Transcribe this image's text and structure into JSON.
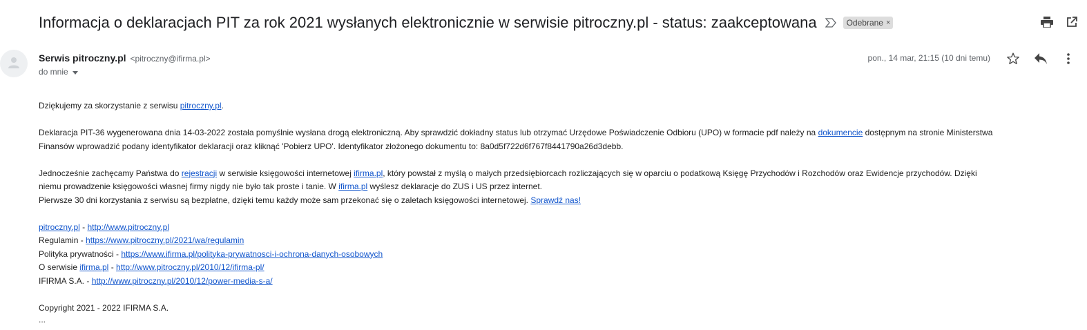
{
  "email": {
    "subject": "Informacja o deklaracjach PIT za rok 2021 wysłanych elektronicznie w serwisie pitroczny.pl - status: zaakceptowana",
    "label": "Odebrane",
    "label_close": "×",
    "sender_name": "Serwis pitroczny.pl",
    "sender_email": "<pitroczny@ifirma.pl>",
    "to": "do mnie",
    "date": "pon., 14 mar, 21:15 (10 dni temu)"
  },
  "body": {
    "p1_text": "Dziękujemy za skorzystanie z serwisu ",
    "p1_link": "pitroczny.pl",
    "p1_end": ".",
    "p2_text_a": "Deklaracja PIT-36 wygenerowana dnia 14-03-2022 została pomyślnie wysłana drogą elektroniczną. Aby sprawdzić dokładny status lub otrzymać Urzędowe Poświadczenie Odbioru (UPO) w formacie pdf należy na ",
    "p2_link": "dokumencie",
    "p2_text_b": " dostępnym na stronie Ministerstwa",
    "p2_text_c": "Finansów wprowadzić podany identyfikator deklaracji oraz kliknąć 'Pobierz UPO'. Identyfikator złożonego dokumentu to: 8a0d5f722d6f767f8441790a26d3debb.",
    "p3_text_a": "Jednocześnie zachęcamy Państwa do ",
    "p3_link_a": "rejestracji",
    "p3_text_b": " w serwisie księgowości internetowej ",
    "p3_link_b": "ifirma.pl",
    "p3_text_c": ", który powstał z myślą o małych przedsiębiorcach rozliczających się w oparciu o podatkową Księgę Przychodów i Rozchodów oraz Ewidencje przychodów. Dzięki",
    "p3_text_d": "niemu prowadzenie księgowości własnej firmy nigdy nie było tak proste i tanie. W ",
    "p3_link_c": "ifirma.pl",
    "p3_text_e": " wyślesz deklaracje do ZUS i US przez internet.",
    "p3_text_f": "Pierwsze 30 dni korzystania z serwisu są bezpłatne, dzięki temu każdy może sam przekonać się o zaletach księgowości internetowej. ",
    "p3_link_d": "Sprawdź nas!",
    "links": {
      "l1_link_a": "pitroczny.pl",
      "l1_sep": " - ",
      "l1_link_b": "http://www.pitroczny.pl",
      "l2_text": "Regulamin - ",
      "l2_link": "https://www.pitroczny.pl/2021/wa/regulamin",
      "l3_text": "Polityka prywatności - ",
      "l3_link": "https://www.ifirma.pl/polityka-prywatnosci-i-ochrona-danych-osobowych",
      "l4_text": "O serwisie ",
      "l4_link_a": "ifirma.pl",
      "l4_sep": " - ",
      "l4_link_b": "http://www.pitroczny.pl/2010/12/ifirma-pl/",
      "l5_text": "IFIRMA S.A. - ",
      "l5_link": "http://www.pitroczny.pl/2010/12/power-media-s-a/"
    },
    "copyright": "Copyright 2021 - 2022 IFIRMA S.A.",
    "ellipsis": "..."
  },
  "icons": {
    "importance": "importance-marker-icon",
    "print": "print-icon",
    "new_window": "open-in-new-window-icon",
    "avatar": "avatar-person-icon",
    "dropdown": "chevron-down-icon",
    "star": "star-icon",
    "reply": "reply-icon",
    "more": "more-vert-icon"
  }
}
